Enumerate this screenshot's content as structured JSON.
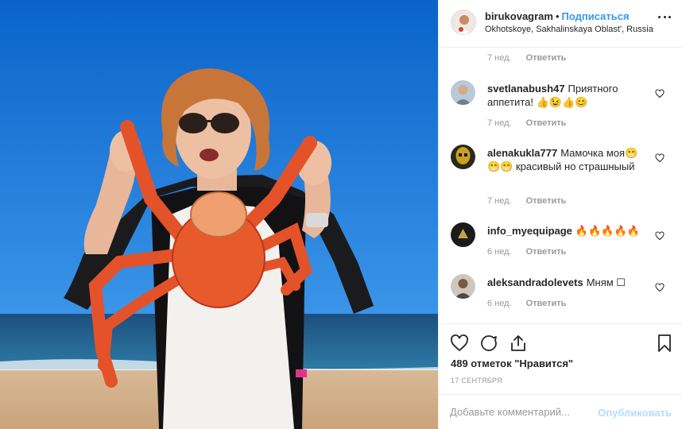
{
  "post": {
    "username": "birukovagram",
    "dot": "•",
    "follow_label": "Подписаться",
    "location": "Okhotskoye, Sakhalinskaya Oblast', Russia"
  },
  "first_meta": {
    "time": "7 нед.",
    "reply": "Ответить"
  },
  "comments": [
    {
      "username": "svetlanabush47",
      "text": "Приятного аппетита! 👍😉👍😊",
      "time": "7 нед.",
      "reply": "Ответить"
    },
    {
      "username": "alenakukla777",
      "text": "Мамочка моя😁😁😁 красивый но страшныый",
      "time": "7 нед.",
      "reply": "Ответить"
    },
    {
      "username": "info_myequipage",
      "text": "🔥🔥🔥🔥🔥",
      "time": "6 нед.",
      "reply": "Ответить"
    },
    {
      "username": "aleksandradolevets",
      "text": "Мням ☐",
      "time": "6 нед.",
      "reply": "Ответить"
    }
  ],
  "likes": "489 отметок \"Нравится\"",
  "date": "17 сентября",
  "add_comment": {
    "placeholder": "Добавьте комментарий...",
    "post_label": "Опубликовать"
  },
  "colors": {
    "link": "#3897f0",
    "post_disabled": "#b2dffc",
    "muted": "#999999"
  },
  "icons": [
    "more-icon",
    "heart-icon",
    "comment-icon",
    "share-icon",
    "bookmark-icon"
  ]
}
